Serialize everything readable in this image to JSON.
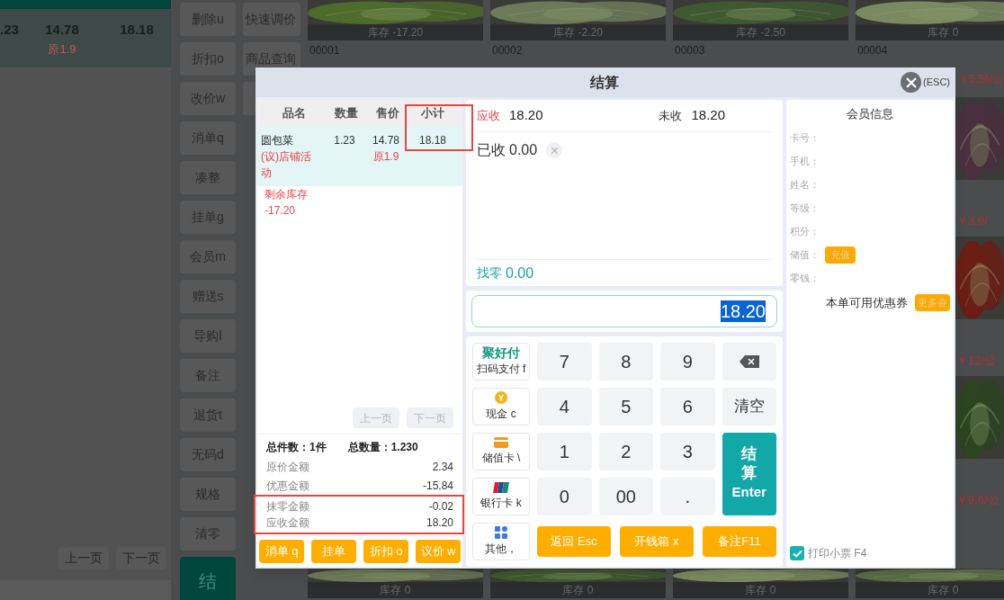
{
  "background": {
    "cart_row": {
      "qty": ".23",
      "price": "14.78",
      "original": "原1.9",
      "subtotal": "18.18"
    },
    "pager": [
      "上一页",
      "下一页"
    ],
    "actions": [
      "删除u",
      "折扣o",
      "改价w",
      "消单q",
      "凑整",
      "挂单g",
      "会员m",
      "赠送s",
      "导购l",
      "备注",
      "退货t",
      "无码d",
      "规格",
      "清零"
    ],
    "checkout": "结",
    "actions_more": [
      "快速调价",
      "商品查询"
    ],
    "products_top": [
      {
        "stock": "库存 -17.20",
        "code": "00001"
      },
      {
        "stock": "库存 -2.20",
        "code": "00002"
      },
      {
        "stock": "库存 -2.50",
        "code": "00003"
      },
      {
        "stock": "库存 0",
        "code": "00004",
        "price": "￥5.56/公"
      }
    ],
    "products_right": [
      {
        "price": "￥3.9/"
      },
      {
        "price": "￥12/公"
      },
      {
        "price": "￥9.6/公"
      }
    ],
    "products_bottom": [
      {
        "stock": "库存 0"
      },
      {
        "stock": "库存 0"
      },
      {
        "stock": "库存 0"
      },
      {
        "stock": "库存 0"
      }
    ]
  },
  "dialog": {
    "title": "结算",
    "close_hint": "(ESC)",
    "table": {
      "columns": [
        "品名",
        "数量",
        "售价",
        "小计"
      ],
      "rows": [
        {
          "name": "圆包菜",
          "promo": "(议)店铺活动",
          "qty": "1.23",
          "price": "14.78",
          "original": "原1.9",
          "subtotal": "18.18",
          "stock_label": "剩余库存",
          "stock": "-17.20",
          "selected": true
        }
      ]
    },
    "pager": [
      {
        "label": "上一页",
        "disabled": true
      },
      {
        "label": "下一页",
        "disabled": true
      }
    ],
    "totals": [
      "总件数：1件",
      "总数量：1.230"
    ],
    "amounts": [
      {
        "label": "原价金额",
        "value": "2.34",
        "highlighted": false
      },
      {
        "label": "优惠金额",
        "value": "-15.84",
        "highlighted": false
      },
      {
        "label": "抹零金额",
        "value": "-0.02",
        "highlighted": true
      },
      {
        "label": "应收金额",
        "value": "18.20",
        "highlighted": true
      }
    ],
    "left_buttons": [
      "消单 q",
      "挂单",
      "折扣 o",
      "议价 w"
    ],
    "payment": {
      "due": {
        "label": "应收",
        "value": "18.20"
      },
      "unpaid": {
        "label": "未收",
        "value": "18.20"
      },
      "received": {
        "label": "已收",
        "value": "0.00"
      },
      "change": {
        "label": "找零",
        "value": "0.00"
      }
    },
    "amount_input": {
      "value": "18.20",
      "text_selected": true
    },
    "pay_methods": [
      {
        "kind": "logo",
        "logo": "聚好付",
        "label": "扫码支付 f"
      },
      {
        "kind": "coin",
        "label": "现金 c"
      },
      {
        "kind": "card",
        "label": "储值卡 \\"
      },
      {
        "kind": "unionpay",
        "label": "银行卡 k"
      },
      {
        "kind": "grid",
        "label": "其他，"
      }
    ],
    "keys": [
      {
        "kind": "digit",
        "label": "7"
      },
      {
        "kind": "digit",
        "label": "8"
      },
      {
        "kind": "digit",
        "label": "9"
      },
      {
        "kind": "backspace"
      },
      {
        "kind": "digit",
        "label": "4"
      },
      {
        "kind": "digit",
        "label": "5"
      },
      {
        "kind": "digit",
        "label": "6"
      },
      {
        "kind": "clear",
        "label": "清空"
      },
      {
        "kind": "digit",
        "label": "1"
      },
      {
        "kind": "digit",
        "label": "2"
      },
      {
        "kind": "digit",
        "label": "3"
      },
      {
        "kind": "enter",
        "label": "结算",
        "hint": "Enter"
      },
      {
        "kind": "digit",
        "label": "0"
      },
      {
        "kind": "digit",
        "label": "00"
      },
      {
        "kind": "digit",
        "label": "."
      }
    ],
    "bottom_buttons": [
      "返回 Esc",
      "开钱箱 x",
      "备注F11"
    ],
    "member": {
      "title": "会员信息",
      "fields": [
        {
          "label": "卡号："
        },
        {
          "label": "手机："
        },
        {
          "label": "姓名："
        },
        {
          "label": "等级："
        },
        {
          "label": "积分："
        },
        {
          "label": "储值：",
          "action": "充值"
        },
        {
          "label": "零钱："
        }
      ],
      "coupon": {
        "label": "本单可用优惠券",
        "action": "更多券"
      },
      "print": {
        "label": "打印小票 F4",
        "checked": true
      }
    }
  }
}
